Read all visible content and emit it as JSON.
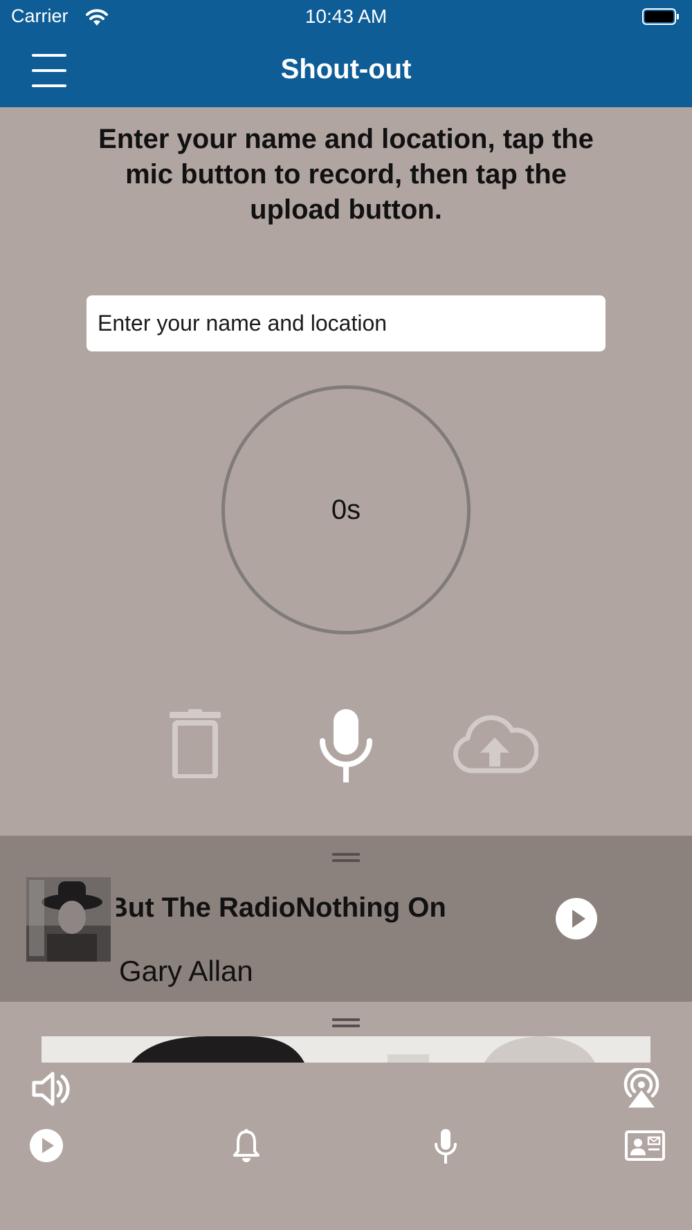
{
  "status_bar": {
    "carrier": "Carrier",
    "time": "10:43 AM"
  },
  "nav": {
    "title": "Shout-out",
    "menu_icon": "hamburger-menu-icon"
  },
  "instructions": "Enter your name and location, tap the mic button to record, then tap the upload button.",
  "name_field": {
    "placeholder": "Enter your name and location",
    "value": ""
  },
  "recorder": {
    "elapsed": "0s",
    "controls": [
      {
        "icon": "trash-icon",
        "enabled": false
      },
      {
        "icon": "mic-icon",
        "enabled": true
      },
      {
        "icon": "cloud-upload-icon",
        "enabled": false
      }
    ]
  },
  "now_playing": {
    "title": "But The RadioNothing On",
    "artist": "Gary Allan",
    "play_icon": "play-icon"
  },
  "bottom_controls": {
    "volume_icon": "volume-icon",
    "airplay_icon": "airplay-icon"
  },
  "tab_bar": [
    {
      "icon": "play-icon"
    },
    {
      "icon": "bell-icon"
    },
    {
      "icon": "mic-icon"
    },
    {
      "icon": "contact-card-icon"
    }
  ],
  "colors": {
    "nav_blue": "#0e5d97",
    "background": "#b1a5a1",
    "player_bar": "#8b817d"
  }
}
